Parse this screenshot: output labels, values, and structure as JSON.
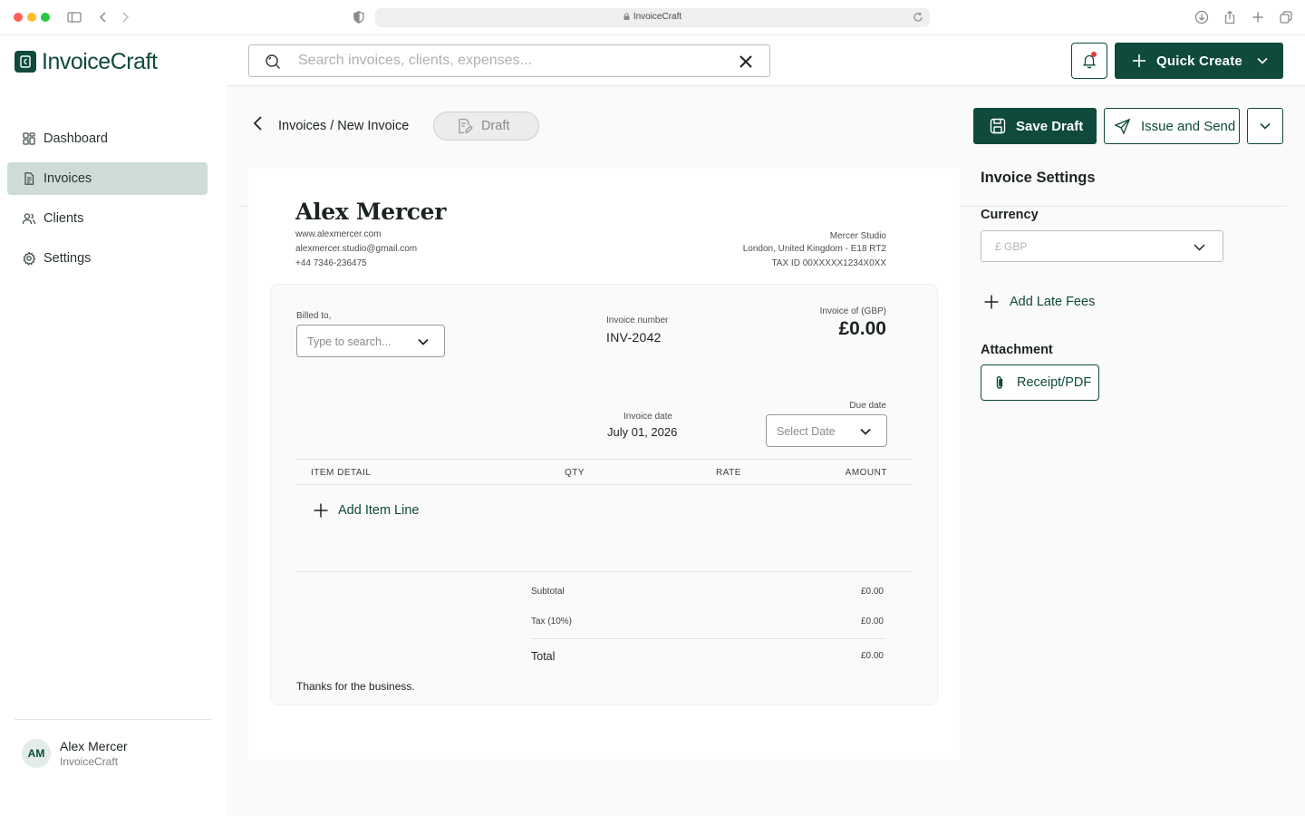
{
  "browser": {
    "url": "InvoiceCraft"
  },
  "app": {
    "name": "InvoiceCraft"
  },
  "sidebar": {
    "items": [
      {
        "label": "Dashboard",
        "icon": "dashboard-icon",
        "active": false
      },
      {
        "label": "Invoices",
        "icon": "file-text-icon",
        "active": true
      },
      {
        "label": "Clients",
        "icon": "users-icon",
        "active": false
      },
      {
        "label": "Settings",
        "icon": "gear-icon",
        "active": false
      }
    ],
    "profile": {
      "initials": "AM",
      "name": "Alex Mercer",
      "org": "InvoiceCraft"
    }
  },
  "topbar": {
    "search_placeholder": "Search invoices, clients, expenses...",
    "quick_create_label": "Quick Create"
  },
  "page": {
    "breadcrumb": "Invoices / New Invoice",
    "status": "Draft",
    "save_draft_label": "Save Draft",
    "issue_send_label": "Issue and Send"
  },
  "invoice": {
    "sender": {
      "name": "Alex Mercer",
      "website": "www.alexmercer.com",
      "email": "alexmercer.studio@gmail.com",
      "phone": "+44 7346-236475"
    },
    "company": {
      "name": "Mercer Studio",
      "address": "London, United Kingdom - E18 RT2",
      "tax_id": "TAX ID 00XXXXX1234X0XX"
    },
    "billed_to_label": "Billed to,",
    "billed_to_placeholder": "Type to search...",
    "number_label": "Invoice number",
    "number": "INV-2042",
    "total_label": "Invoice of (GBP)",
    "total": "£0.00",
    "date_label": "Invoice date",
    "date": "July 01, 2026",
    "due_label": "Due date",
    "due_placeholder": "Select Date",
    "columns": [
      "ITEM DETAIL",
      "QTY",
      "RATE",
      "AMOUNT"
    ],
    "add_item_label": "Add Item Line",
    "subtotal_label": "Subtotal",
    "subtotal": "£0.00",
    "tax_label": "Tax (10%)",
    "tax": "£0.00",
    "grand_total_label": "Total",
    "grand_total": "£0.00",
    "note": "Thanks for the business."
  },
  "settings": {
    "title": "Invoice Settings",
    "currency_label": "Currency",
    "currency_value": "£ GBP",
    "late_fees_label": "Add Late Fees",
    "attachment_label": "Attachment",
    "attachment_button": "Receipt/PDF"
  },
  "colors": {
    "brand": "#0f4a3c",
    "nav_active": "#cddcd8",
    "notification": "#e23a3a"
  }
}
